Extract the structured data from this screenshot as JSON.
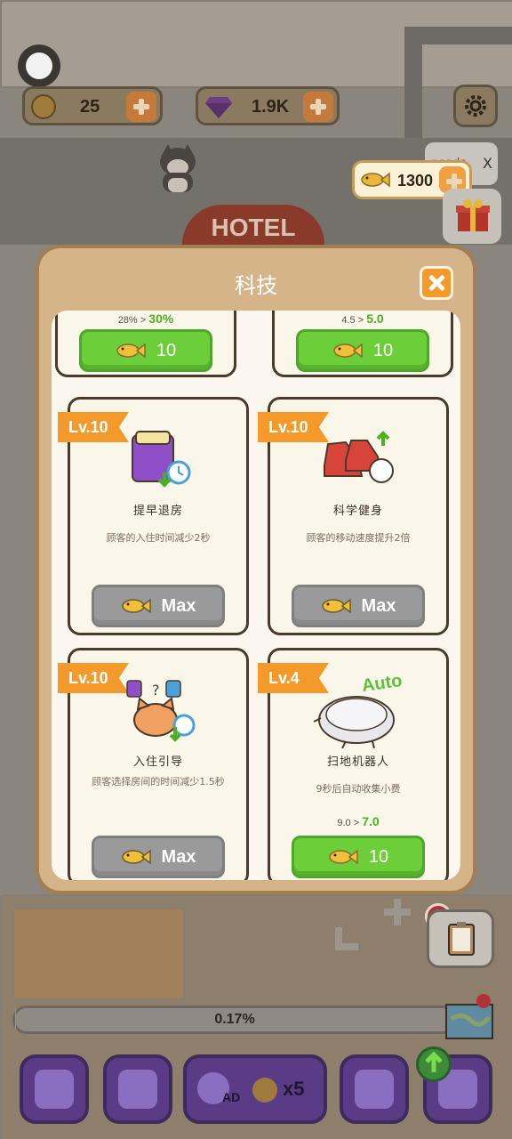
{
  "hud": {
    "coins": "25",
    "gems": "1.9K",
    "fish": "1300",
    "noads": "noads",
    "close_x": "X"
  },
  "scene": {
    "hotel_sign": "HOTEL"
  },
  "modal": {
    "title": "科技",
    "top_cards": [
      {
        "stat_old": "28%",
        "stat_arrow": ">",
        "stat_new": "30%",
        "price": "10"
      },
      {
        "stat_old": "4.5",
        "stat_arrow": ">",
        "stat_new": "5.0",
        "price": "10"
      }
    ],
    "cards": [
      {
        "level": "Lv.10",
        "name": "提早退房",
        "desc": "顾客的入住时间减少2秒",
        "button": "Max",
        "maxed": true
      },
      {
        "level": "Lv.10",
        "name": "科学健身",
        "desc": "顾客的移动速度提升2倍",
        "button": "Max",
        "maxed": true
      },
      {
        "level": "Lv.10",
        "name": "入住引导",
        "desc": "顾客选择房间的时间减少1.5秒",
        "button": "Max",
        "maxed": true
      },
      {
        "level": "Lv.4",
        "name": "扫地机器人",
        "desc": "9秒后自动收集小费",
        "stat_old": "9.0",
        "stat_arrow": ">",
        "stat_new": "7.0",
        "button": "10",
        "maxed": false,
        "badge": "Auto"
      }
    ]
  },
  "bottom": {
    "progress_label": "0.17%",
    "progress_fraction": 0.0017,
    "ad_label": "AD",
    "ad_multiplier": "x5"
  }
}
